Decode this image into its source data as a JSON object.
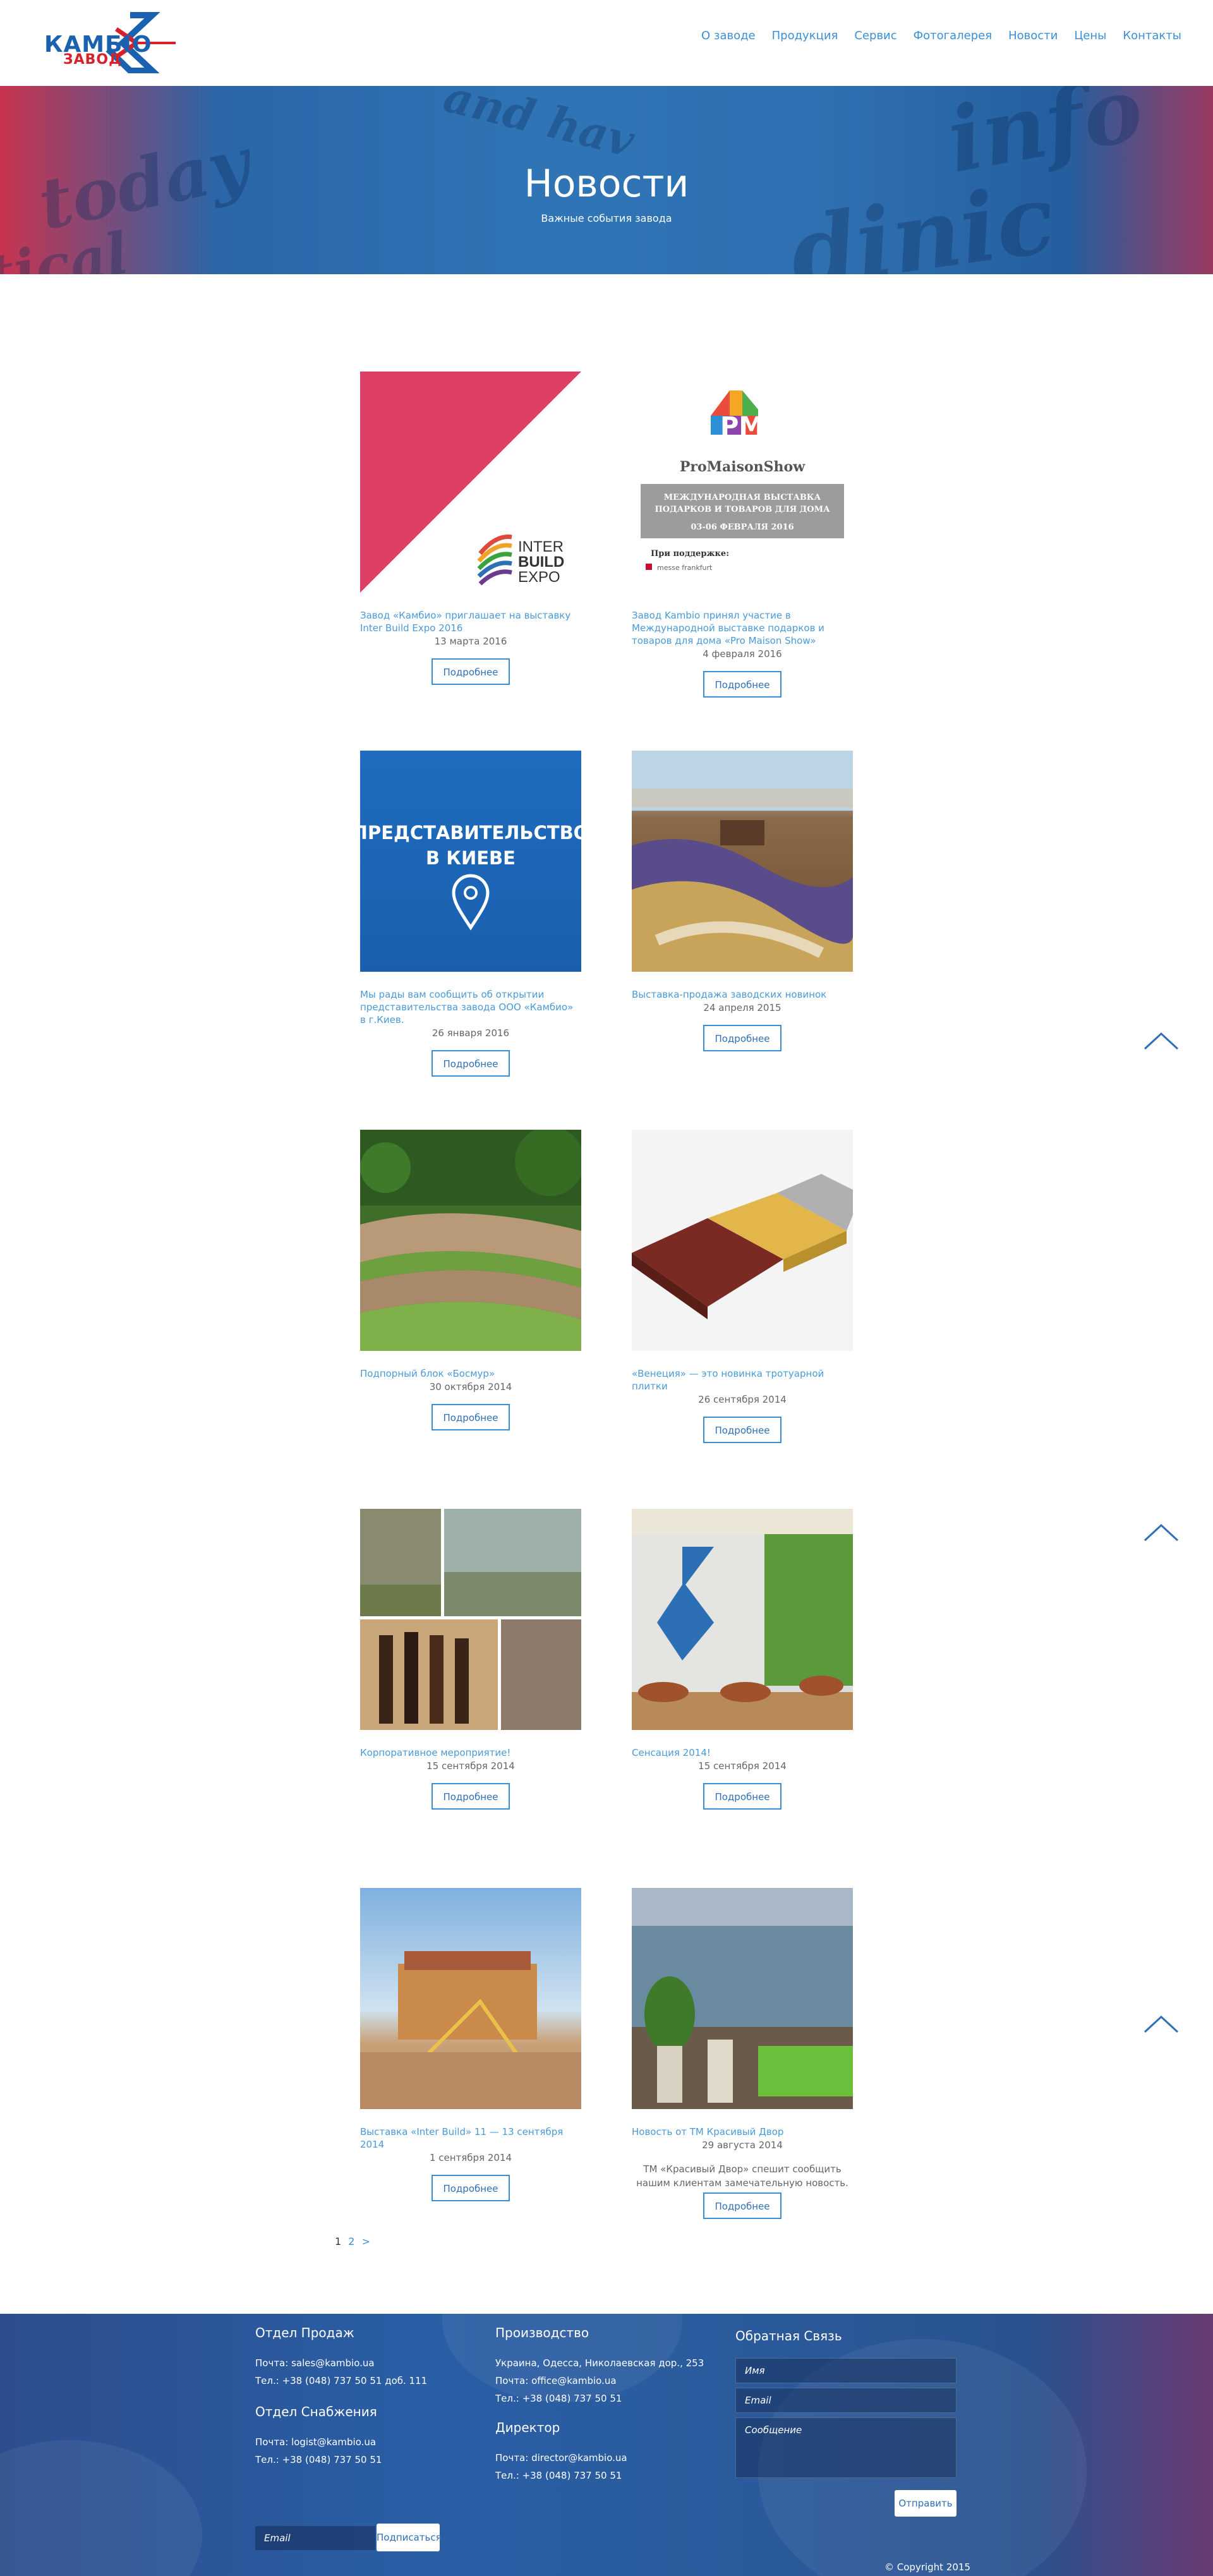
{
  "header": {
    "logo_line1": "КАМБІО",
    "logo_line2": "ЗАВОД",
    "nav": [
      "О заводе",
      "Продукция",
      "Сервис",
      "Фотогалерея",
      "Новости",
      "Цены",
      "Контакты"
    ]
  },
  "banner": {
    "title": "Новости",
    "subtitle": "Важные события завода"
  },
  "more_label": "Подробнее",
  "news": [
    {
      "title": "Завод «Камбио» приглашает на выставку Inter Build Expo 2016",
      "date": "13 марта 2016",
      "image_text": [
        "INTER",
        "BUILD",
        "EXPO"
      ]
    },
    {
      "title": "Завод Kambio принял участие в Международной выставке подарков и товаров для дома «Pro Maison Show»",
      "date": "4 февраля 2016",
      "image_text": [
        "PMS",
        "ProMaisonShow",
        "МЕЖДУНАРОДНАЯ ВЫСТАВКА",
        "ПОДАРКОВ И ТОВАРОВ ДЛЯ ДОМА",
        "03-06 ФЕВРАЛЯ 2016",
        "При поддержке:",
        "messe frankfurt"
      ]
    },
    {
      "title": "Мы рады вам сообщить об открытии представительства завода ООО «Камбио» в г.Киев.",
      "date": "26 января 2016",
      "image_text": [
        "ПРЕДСТАВИТЕЛЬСТВО",
        "В КИЕВЕ"
      ]
    },
    {
      "title": "Выставка-продажа заводских новинок",
      "date": "24 апреля 2015"
    },
    {
      "title": "Подпорный блок «Босмур»",
      "date": "30 октября 2014"
    },
    {
      "title": "«Венеция» — это новинка тротуарной плитки",
      "date": "26 сентября 2014"
    },
    {
      "title": "Корпоративное мероприятие!",
      "date": "15 сентября 2014"
    },
    {
      "title": "Сенсация 2014!",
      "date": "15 сентября 2014"
    },
    {
      "title": "Выставка «Inter Build» 11 — 13 сентября 2014",
      "date": "1 сентября 2014"
    },
    {
      "title": "Новость от ТМ Красивый Двор",
      "date": "29 августа 2014",
      "excerpt": "ТМ «Красивый Двор» спешит сообщить нашим клиентам замечательную новость."
    }
  ],
  "pagination": {
    "current": "1",
    "next": "2",
    "arrow": ">"
  },
  "footer": {
    "sales": {
      "title": "Отдел Продаж",
      "mail": "Почта: sales@kambio.ua",
      "phone": "Тел.: +38 (048) 737 50 51 доб. 111"
    },
    "supply": {
      "title": "Отдел Снабжения",
      "mail": "Почта: logist@kambio.ua",
      "phone": "Тел.: +38 (048) 737 50 51"
    },
    "production": {
      "title": "Производство",
      "address": "Украина, Одесса, Николаевская дор., 253",
      "mail": "Почта: office@kambio.ua",
      "phone": "Тел.: +38 (048) 737 50 51"
    },
    "director": {
      "title": "Директор",
      "mail": "Почта: director@kambio.ua",
      "phone": "Тел.: +38 (048) 737 50 51"
    },
    "feedback": {
      "title": "Обратная Связь",
      "name_ph": "Имя",
      "email_ph": "Email",
      "message_ph": "Сообщение",
      "send": "Отправить"
    },
    "subscribe": {
      "placeholder": "Email",
      "button": "Подписаться"
    },
    "copyright": "© Copyright 2015"
  }
}
